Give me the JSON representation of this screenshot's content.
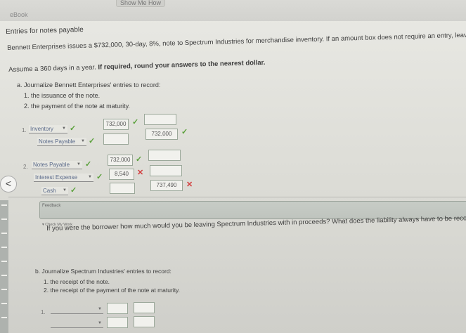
{
  "header": {
    "ebook": "eBook",
    "show_me": "Show Me How"
  },
  "title": "Entries for notes payable",
  "intro": {
    "line1": "Bennett Enterprises issues a $732,000, 30-day, 8%, note to Spectrum Industries for merchandise inventory. If an amount box does not require an entry, leave it blank.",
    "line2_normal": "Assume a 360 days in a year.",
    "line2_bold": "If required, round your answers to the nearest dollar."
  },
  "part_a": {
    "heading": "a.  Journalize Bennett Enterprises' entries to record:",
    "item1": "1. the issuance of the note.",
    "item2": "2. the payment of the note at maturity.",
    "entry1": {
      "number": "1.",
      "row1": {
        "account": "Inventory",
        "debit": "732,000",
        "credit": ""
      },
      "row2": {
        "account": "Notes Payable",
        "debit": "",
        "credit": "732,000"
      }
    },
    "entry2": {
      "number": "2.",
      "row1": {
        "account": "Notes Payable",
        "debit": "732,000",
        "credit": ""
      },
      "row2": {
        "account": "Interest Expense",
        "debit": "8,540",
        "credit": ""
      },
      "row3": {
        "account": "Cash",
        "debit": "",
        "credit": "737,490"
      }
    }
  },
  "feedback": {
    "label": "Feedback",
    "check": "Check My Work",
    "hint": "If you were the borrower how much would you be leaving Spectrum Industries with in proceeds? What does the liability always have to be reco"
  },
  "part_b": {
    "heading": "b.  Journalize Spectrum Industries' entries to record:",
    "item1": "1. the receipt of the note.",
    "item2": "2. the receipt of the payment of the note at maturity.",
    "entry1": {
      "number": "1."
    }
  },
  "nav": {
    "prev_arrow": "<"
  },
  "colors": {
    "correct": "#5aa03a",
    "incorrect": "#d23c3c"
  }
}
